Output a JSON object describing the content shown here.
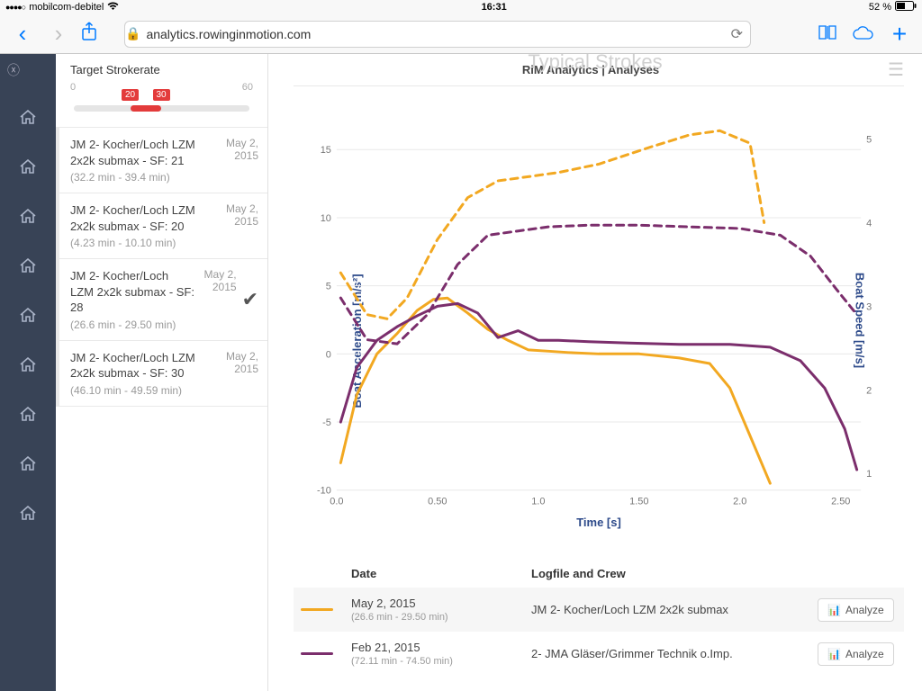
{
  "status": {
    "carrier": "mobilcom-debitel",
    "time": "16:31",
    "battery": "52 %"
  },
  "safari": {
    "url": "analytics.rowinginmotion.com"
  },
  "page": {
    "title": "RiM Analytics | Analyses",
    "overlay": "Typical Strokes"
  },
  "slider": {
    "label": "Target Strokerate",
    "min": "0",
    "max": "60",
    "lo": "20",
    "hi": "30",
    "lo_pct": 33,
    "hi_pct": 50
  },
  "segments": [
    {
      "title": "JM 2- Kocher/Loch LZM 2x2k submax - SF: 21",
      "range": "(32.2 min - 39.4 min)",
      "date": "May 2, 2015",
      "checked": false
    },
    {
      "title": "JM 2- Kocher/Loch LZM 2x2k submax - SF: 20",
      "range": "(4.23 min - 10.10 min)",
      "date": "May 2, 2015",
      "checked": false
    },
    {
      "title": "JM 2- Kocher/Loch LZM 2x2k submax - SF: 28",
      "range": "(26.6 min - 29.50 min)",
      "date": "May 2, 2015",
      "checked": true
    },
    {
      "title": "JM 2- Kocher/Loch LZM 2x2k submax - SF: 30",
      "range": "(46.10 min - 49.59 min)",
      "date": "May 2, 2015",
      "checked": false
    }
  ],
  "axes": {
    "left": "Boat Acceleration [m/s²]",
    "right": "Boat Speed [m/s]",
    "bottom": "Time [s]"
  },
  "colors": {
    "orange": "#f2a821",
    "purple": "#7b2e6c"
  },
  "table": {
    "headers": {
      "date": "Date",
      "log": "Logfile and Crew",
      "action": "Analyze"
    },
    "rows": [
      {
        "color": "#f2a821",
        "date": "May 2, 2015",
        "range": "(26.6 min - 29.50 min)",
        "log": "JM 2- Kocher/Loch LZM 2x2k submax"
      },
      {
        "color": "#7b2e6c",
        "date": "Feb 21, 2015",
        "range": "(72.11 min - 74.50 min)",
        "log": "2- JMA Gläser/Grimmer Technik o.Imp."
      }
    ]
  },
  "chart_data": {
    "type": "line",
    "xlabel": "Time [s]",
    "ylabel_left": "Boat Acceleration [m/s²]",
    "ylabel_right": "Boat Speed [m/s]",
    "xlim": [
      0,
      2.6
    ],
    "ylim_left": [
      -10,
      17
    ],
    "ylim_right": [
      0.8,
      5.2
    ],
    "xticks": [
      0.0,
      0.5,
      1.0,
      1.5,
      2.0,
      2.5
    ],
    "yticks_left": [
      -10,
      -5,
      0,
      5,
      10,
      15
    ],
    "yticks_right": [
      1,
      2,
      3,
      4,
      5
    ],
    "series": [
      {
        "name": "accel_orange",
        "color": "#f2a821",
        "axis": "left",
        "dashed": false,
        "x": [
          0.02,
          0.1,
          0.2,
          0.3,
          0.4,
          0.48,
          0.55,
          0.65,
          0.75,
          0.85,
          0.95,
          1.05,
          1.15,
          1.3,
          1.5,
          1.7,
          1.85,
          1.95,
          2.05,
          2.15
        ],
        "y": [
          -8.0,
          -3.0,
          0.0,
          1.5,
          3.2,
          4.0,
          4.1,
          3.0,
          1.8,
          1.0,
          0.3,
          0.2,
          0.1,
          0.0,
          0.0,
          -0.3,
          -0.7,
          -2.5,
          -6.0,
          -9.5
        ]
      },
      {
        "name": "accel_purple",
        "color": "#7b2e6c",
        "axis": "left",
        "dashed": false,
        "x": [
          0.02,
          0.1,
          0.2,
          0.3,
          0.4,
          0.5,
          0.6,
          0.7,
          0.8,
          0.9,
          1.0,
          1.1,
          1.25,
          1.45,
          1.7,
          1.95,
          2.15,
          2.3,
          2.42,
          2.52,
          2.58
        ],
        "y": [
          -5.0,
          -1.0,
          1.0,
          2.0,
          2.8,
          3.5,
          3.7,
          3.0,
          1.2,
          1.7,
          1.0,
          1.0,
          0.9,
          0.8,
          0.7,
          0.7,
          0.5,
          -0.5,
          -2.5,
          -5.5,
          -8.5
        ]
      },
      {
        "name": "speed_orange",
        "color": "#f2a821",
        "axis": "right",
        "dashed": true,
        "x": [
          0.02,
          0.15,
          0.25,
          0.35,
          0.5,
          0.65,
          0.8,
          0.95,
          1.1,
          1.3,
          1.55,
          1.75,
          1.9,
          2.05,
          2.12
        ],
        "y": [
          3.4,
          2.9,
          2.85,
          3.1,
          3.8,
          4.3,
          4.5,
          4.55,
          4.6,
          4.7,
          4.9,
          5.05,
          5.1,
          4.95,
          4.0
        ]
      },
      {
        "name": "speed_purple",
        "color": "#7b2e6c",
        "axis": "right",
        "dashed": true,
        "x": [
          0.02,
          0.15,
          0.3,
          0.45,
          0.6,
          0.75,
          0.9,
          1.05,
          1.25,
          1.5,
          1.75,
          2.0,
          2.2,
          2.35,
          2.48,
          2.58
        ],
        "y": [
          3.1,
          2.6,
          2.55,
          2.9,
          3.5,
          3.85,
          3.9,
          3.95,
          3.97,
          3.97,
          3.95,
          3.93,
          3.85,
          3.6,
          3.2,
          2.9
        ]
      }
    ]
  }
}
